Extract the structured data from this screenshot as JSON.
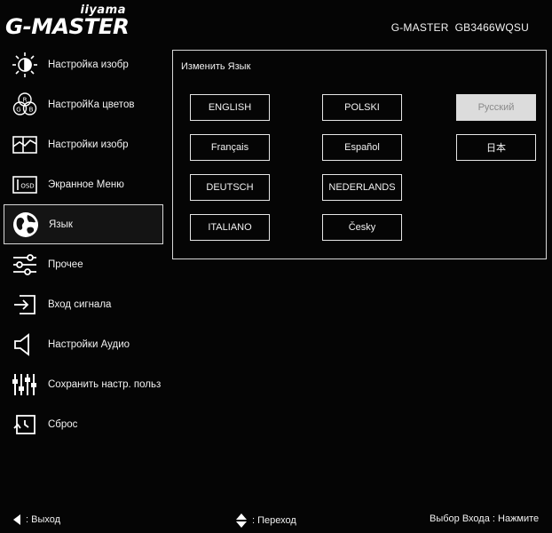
{
  "header": {
    "brand": "iiyama",
    "product_line": "G-MASTER",
    "model_series": "G-MASTER",
    "model_number": "GB3466WQSU"
  },
  "sidebar": {
    "items": [
      {
        "label": "Настройка изобр",
        "icon": "brightness-icon"
      },
      {
        "label": "НастройКа цветов",
        "icon": "rgb-icon"
      },
      {
        "label": "Настройки изобр",
        "icon": "picture-icon"
      },
      {
        "label": "Экранное Меню",
        "icon": "osd-icon",
        "icon_text": "OSD"
      },
      {
        "label": "Язык",
        "icon": "globe-icon",
        "selected": true
      },
      {
        "label": "Прочее",
        "icon": "sliders-icon"
      },
      {
        "label": "Вход сигнала",
        "icon": "input-icon"
      },
      {
        "label": "Настройки Аудио",
        "icon": "speaker-icon"
      },
      {
        "label": "Сохранить настр. польз",
        "icon": "equalizer-icon"
      },
      {
        "label": "Сброс",
        "icon": "reset-icon"
      }
    ]
  },
  "language_panel": {
    "title": "Изменить Язык",
    "languages": [
      {
        "label": "ENGLISH"
      },
      {
        "label": "POLSKI"
      },
      {
        "label": "Русский",
        "selected": true
      },
      {
        "label": "Français"
      },
      {
        "label": "Español"
      },
      {
        "label": "日本"
      },
      {
        "label": "DEUTSCH"
      },
      {
        "label": "NEDERLANDS"
      },
      {
        "label": "ITALIANO"
      },
      {
        "label": "Česky"
      }
    ]
  },
  "footer": {
    "exit_label": ": Выход",
    "navigate_label": ": Переход",
    "input_label": "Выбор Входа : Нажмите"
  },
  "colors": {
    "background": "#050505",
    "text": "#f0f0f0",
    "selected_button_bg": "#dcdcdc",
    "selected_button_text": "#8a8a8a"
  }
}
